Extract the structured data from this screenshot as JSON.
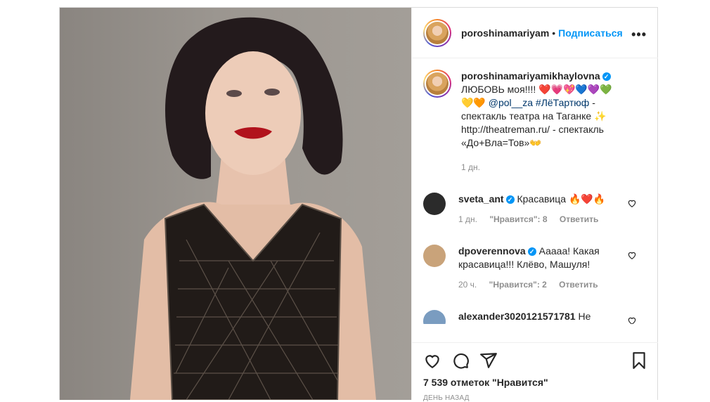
{
  "post": {
    "username": "poroshinamariyam",
    "dot": "•",
    "follow_label": "Подписаться",
    "more_label": "•••"
  },
  "caption": {
    "username": "poroshinamariyamikhaylovna",
    "line1": "ЛЮБОВЬ моя!!!! ❤️💗💖💙💜💚",
    "line2_emoji": "💛🧡 ",
    "mention": "@pol__za",
    "hashtag": "#ЛёТартюф",
    "text_rest": " - спектакль театра на Таганке ✨ http://theatreman.ru/ - спектакль «До+Вла=Тов»👐",
    "time": "1 дн."
  },
  "comments": [
    {
      "username": "sveta_ant",
      "text": "Красавица 🔥❤️🔥",
      "time": "1 дн.",
      "likes": "\"Нравится\": 8",
      "reply": "Ответить",
      "avatar_color": "#2b2b2b"
    },
    {
      "username": "dpoverennova",
      "text": "Ааааа! Какая красавица!!! Клёво, Машуля!",
      "time": "20 ч.",
      "likes": "\"Нравится\": 2",
      "reply": "Ответить",
      "avatar_color": "#c9a37a"
    },
    {
      "username": "alexander3020121571781",
      "text": "Не знаю кто это но высокомерная",
      "avatar_color": "#7a9cc0"
    }
  ],
  "actions": {
    "icons": [
      "heart-icon",
      "comment-icon",
      "share-icon",
      "bookmark-icon"
    ]
  },
  "likes_text": "7 539 отметок \"Нравится\"",
  "date_text": "ДЕНЬ НАЗАД",
  "colors": {
    "accent": "#0095f6",
    "border": "#dbdbdb",
    "muted": "#8e8e8e"
  }
}
